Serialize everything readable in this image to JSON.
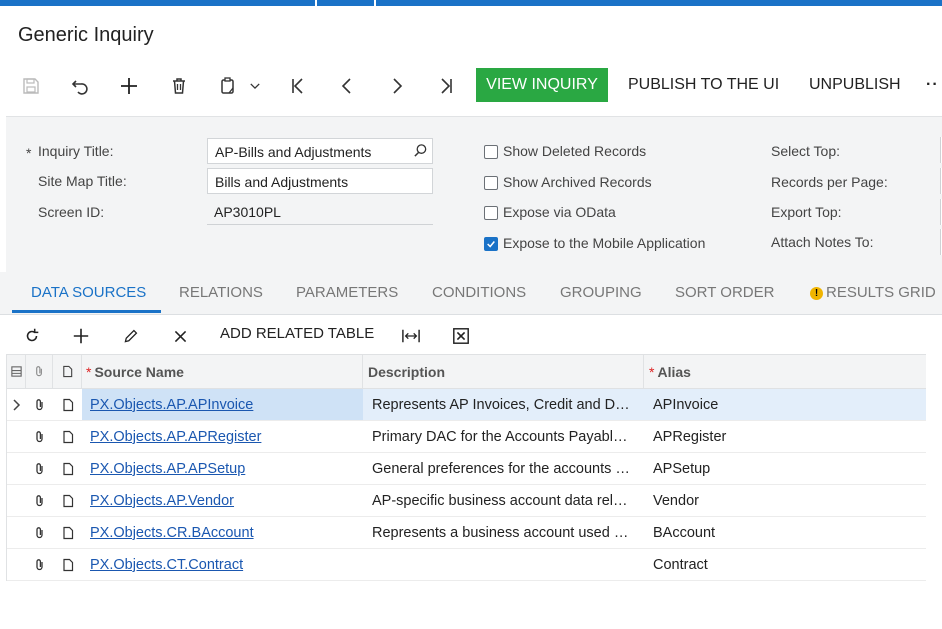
{
  "page": {
    "title": "Generic Inquiry"
  },
  "toolbar": {
    "icons": [
      "save-icon",
      "undo-icon",
      "add-icon",
      "delete-icon",
      "copy-paste-icon",
      "chevron-down-icon",
      "first-page-icon",
      "prev-page-icon",
      "next-page-icon",
      "last-page-icon"
    ],
    "view_inquiry": "VIEW INQUIRY",
    "publish": "PUBLISH TO THE UI",
    "unpublish": "UNPUBLISH",
    "more": "··"
  },
  "form": {
    "inquiry_title_label": "Inquiry Title:",
    "inquiry_title_value": "AP-Bills and Adjustments",
    "site_map_title_label": "Site Map Title:",
    "site_map_title_value": "Bills and Adjustments",
    "screen_id_label": "Screen ID:",
    "screen_id_value": "AP3010PL",
    "required_mark": "*",
    "checkboxes": [
      {
        "label": "Show Deleted Records",
        "checked": false
      },
      {
        "label": "Show Archived Records",
        "checked": false
      },
      {
        "label": "Expose via OData",
        "checked": false
      },
      {
        "label": "Expose to the Mobile Application",
        "checked": true
      }
    ],
    "right_labels": [
      "Select Top:",
      "Records per Page:",
      "Export Top:",
      "Attach Notes To:"
    ]
  },
  "tabs": [
    {
      "label": "DATA SOURCES",
      "active": true
    },
    {
      "label": "RELATIONS",
      "active": false
    },
    {
      "label": "PARAMETERS",
      "active": false
    },
    {
      "label": "CONDITIONS",
      "active": false
    },
    {
      "label": "GROUPING",
      "active": false
    },
    {
      "label": "SORT ORDER",
      "active": false
    },
    {
      "label": "RESULTS GRID",
      "active": false,
      "warning": "!"
    }
  ],
  "grid_toolbar": {
    "icons": [
      "refresh-icon",
      "add-row-icon",
      "edit-icon",
      "delete-row-icon",
      "fit-columns-icon",
      "export-excel-icon"
    ],
    "add_related_table": "ADD RELATED TABLE"
  },
  "grid": {
    "columns": {
      "source_name": "Source Name",
      "description": "Description",
      "alias": "Alias",
      "required_mark": "*"
    },
    "rows": [
      {
        "source": "PX.Objects.AP.APInvoice",
        "description": "Represents AP Invoices, Credit and D…",
        "alias": "APInvoice",
        "selected": true
      },
      {
        "source": "PX.Objects.AP.APRegister",
        "description": "Primary DAC for the Accounts Payabl…",
        "alias": "APRegister",
        "selected": false
      },
      {
        "source": "PX.Objects.AP.APSetup",
        "description": "General preferences for the accounts …",
        "alias": "APSetup",
        "selected": false
      },
      {
        "source": "PX.Objects.AP.Vendor",
        "description": "AP-specific business account data rel…",
        "alias": "Vendor",
        "selected": false
      },
      {
        "source": "PX.Objects.CR.BAccount",
        "description": "Represents a business account used …",
        "alias": "BAccount",
        "selected": false
      },
      {
        "source": "PX.Objects.CT.Contract",
        "description": "",
        "alias": "Contract",
        "selected": false
      }
    ]
  },
  "colors": {
    "accent": "#1a72c7",
    "view_button": "#2aa843",
    "panel": "#f3f4f5",
    "link": "#1a57b0",
    "selected_row": "#e3eefa"
  }
}
